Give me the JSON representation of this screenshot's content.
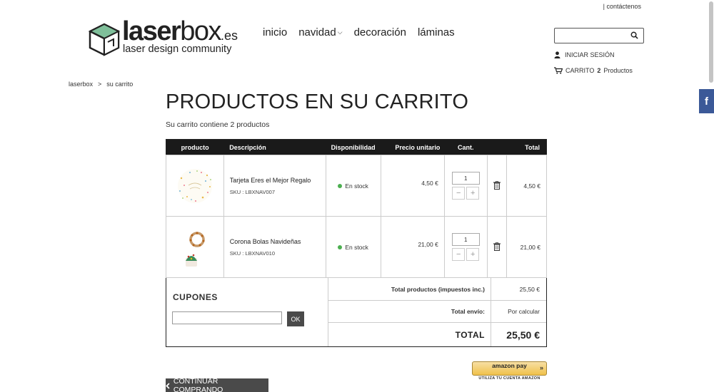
{
  "top": {
    "contact_link": "| contáctenos"
  },
  "logo": {
    "brand_bold": "laser",
    "brand_light": "box",
    "brand_tld": ".es",
    "tagline": "laser design community"
  },
  "nav": {
    "items": [
      "inicio",
      "navidad",
      "decoración",
      "láminas"
    ]
  },
  "search": {
    "placeholder": "",
    "icon": "search-icon"
  },
  "account": {
    "login_label": "INICIAR SESIÓN",
    "cart_label": "CARRITO",
    "cart_count": "2",
    "cart_suffix": "Productos"
  },
  "breadcrumb": {
    "home": "laserbox",
    "separator": ">",
    "current": "su carrito"
  },
  "page": {
    "title": "PRODUCTOS EN SU CARRITO",
    "summary": "Su carrito contiene 2 productos"
  },
  "table": {
    "headers": {
      "product": "producto",
      "description": "Descripción",
      "availability": "Disponibilidad",
      "unit_price": "Precio unitario",
      "qty": "Cant.",
      "total": "Total"
    },
    "rows": [
      {
        "name": "Tarjeta Eres el Mejor Regalo",
        "sku": "SKU : LBXNAV007",
        "stock": "En stock",
        "unit_price": "4,50 €",
        "qty": "1",
        "total": "4,50 €"
      },
      {
        "name": "Corona Bolas Navideñas",
        "sku": "SKU : LBXNAV010",
        "stock": "En stock",
        "unit_price": "21,00 €",
        "qty": "1",
        "total": "21,00 €"
      }
    ]
  },
  "coupons": {
    "title": "CUPONES",
    "button": "OK"
  },
  "totals": {
    "products_label": "Total productos (impuestos inc.)",
    "products_value": "25,50 €",
    "shipping_label": "Total envío:",
    "shipping_value": "Por calcular",
    "total_label": "TOTAL",
    "total_value": "25,50 €"
  },
  "amazon": {
    "line1": "amazon pay",
    "line2": "UTILIZA TU CUENTA AMAZON"
  },
  "continue": {
    "label": "CONTINUAR COMPRANDO"
  },
  "social": {
    "facebook": "f"
  },
  "colors": {
    "header_bg": "#1a1a1a",
    "stock_dot": "#4caf50",
    "facebook": "#3b5998",
    "amazon": "#f0c14b"
  }
}
